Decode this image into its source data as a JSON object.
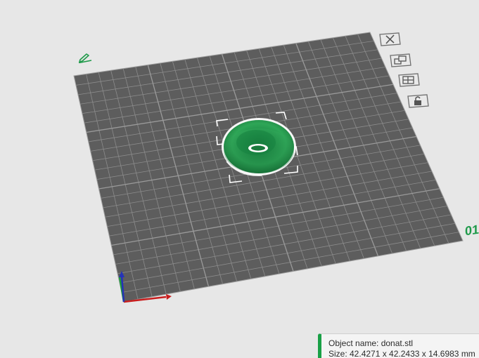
{
  "scene": {
    "bed_number": "01",
    "colors": {
      "background": "#e7e7e7",
      "bed_surface": "#5c5c5c",
      "bed_grid": "#8a8a8a",
      "accent": "#19a046",
      "object": "#2aa052"
    }
  },
  "toolbar": {
    "icons": [
      "close-icon",
      "arrange-icon",
      "layers-icon",
      "lock-icon"
    ]
  },
  "object_info": {
    "name_line": "Object name: donat.stl",
    "size_line": "Size: 42.4271 x 42.2433 x 14.6983 mm"
  }
}
